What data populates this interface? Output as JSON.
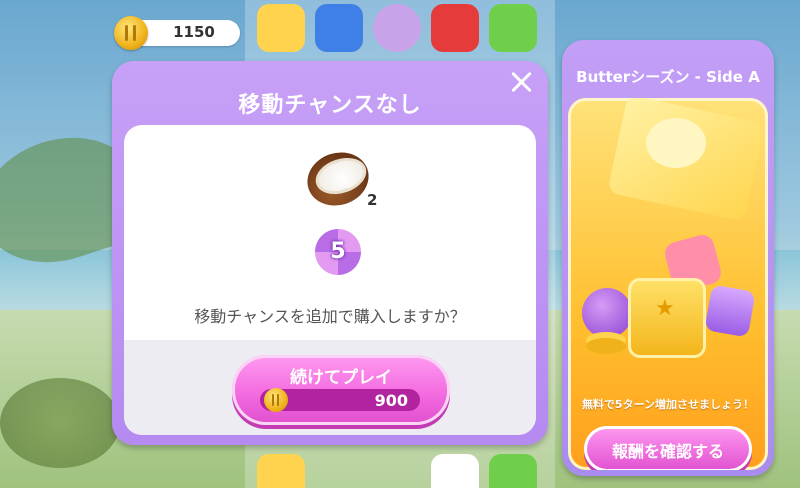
{
  "currency": {
    "coins": "1150"
  },
  "dialog": {
    "title": "移動チャンスなし",
    "item_quantity": "2",
    "moves_added": "5",
    "question": "移動チャンスを追加で購入しますか？",
    "continue_label": "続けてプレイ",
    "price": "900"
  },
  "event": {
    "title": "Butterシーズン - Side A",
    "description": "無料で5ターン増加させましょう！",
    "button_label": "報酬を確認する"
  }
}
